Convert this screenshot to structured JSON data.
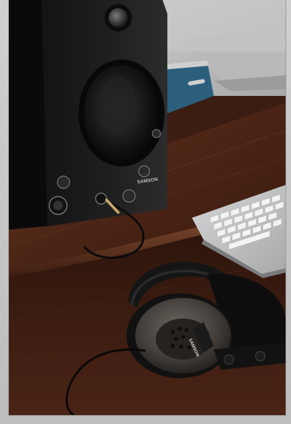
{
  "photo": {
    "subject": "studio-monitor-headphones-keyboard",
    "colors": {
      "wood_dark": "#2a130b",
      "wood_mid": "#4a2416",
      "wood_light": "#6b3a24",
      "speaker_body": "#1a1a1a",
      "keyboard": "#e8e8e8",
      "headphone_cup": "#4a4541"
    }
  },
  "speaker": {
    "brand_text": "SAMSON"
  },
  "headphones": {
    "brand_text": "SAMSON"
  }
}
